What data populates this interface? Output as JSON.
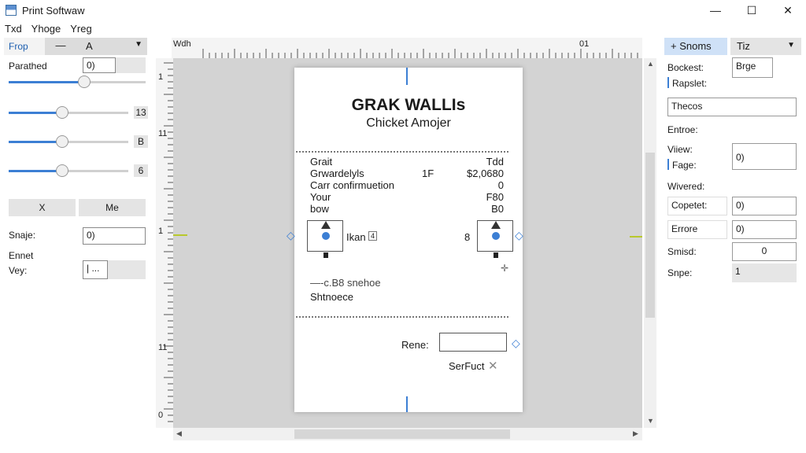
{
  "window": {
    "title": "Print Softwaw",
    "minimize": "—",
    "maximize": "☐",
    "close": "✕"
  },
  "menu": [
    "Txd",
    "Yhoge",
    "Yreg"
  ],
  "left_panel": {
    "tab_a": "Frop",
    "tab_b": "—",
    "tab_c": "A",
    "param_label": "Parathed",
    "param_value": "0)",
    "sliders": [
      {
        "value": 0.55,
        "label": ""
      },
      {
        "value": 0.45,
        "label": "13"
      },
      {
        "value": 0.45,
        "label": "B"
      },
      {
        "value": 0.45,
        "label": "6"
      }
    ],
    "btn_x": "X",
    "btn_me": "Me",
    "shape_label": "Snaje:",
    "shape_value": "0)",
    "ennet_label": "Ennet",
    "vey_label": "Vey:",
    "vey_value": "| ..."
  },
  "canvas": {
    "ruler_top_left": "Wdh",
    "ruler_top_right": "01",
    "ruler_left_marks": [
      "1",
      "11",
      "1",
      "11",
      "0"
    ],
    "receipt": {
      "title": "GRAK WALLIs",
      "subtitle": "Chicket Amojer",
      "lines": [
        {
          "left": "Grait",
          "mid": "",
          "right": "Tdd"
        },
        {
          "left": "Grwardelyls",
          "mid": "1F",
          "right": "$2,0680"
        },
        {
          "left": "Carr confirmuetion",
          "mid": "",
          "right": "0"
        },
        {
          "left": "Your",
          "mid": "",
          "right": "F80"
        },
        {
          "left": "bow",
          "mid": "",
          "right": "B0"
        }
      ],
      "handle_left_label": "Ikan",
      "handle_left_small": "4",
      "handle_right_label": "8",
      "foot_line_1": "—-c.B8 snehoe",
      "foot_line_2": "Shtnoece",
      "rene_label": "Rene:",
      "serfuct_label": "SerFuct",
      "serfuct_icon": "✕"
    }
  },
  "right_panel": {
    "tab_a": "+ Snoms",
    "tab_b": "Tiz",
    "bockest_label": "Bockest:",
    "bockest_value": "Brge",
    "rapslet_label": "Rapslet:",
    "thecos_value": "Thecos",
    "entroe_label": "Entroe:",
    "view_label": "Viiew:",
    "fage_label": "Fage:",
    "fage_value": "0)",
    "wivered_label": "Wivered:",
    "copetet_label": "Copetet:",
    "copetet_value": "0)",
    "errore_label": "Errore",
    "errore_value": "0)",
    "smisd_label": "Smisd:",
    "smisd_value": "0",
    "snpe_label": "Snpe:",
    "snpe_value": "1"
  }
}
